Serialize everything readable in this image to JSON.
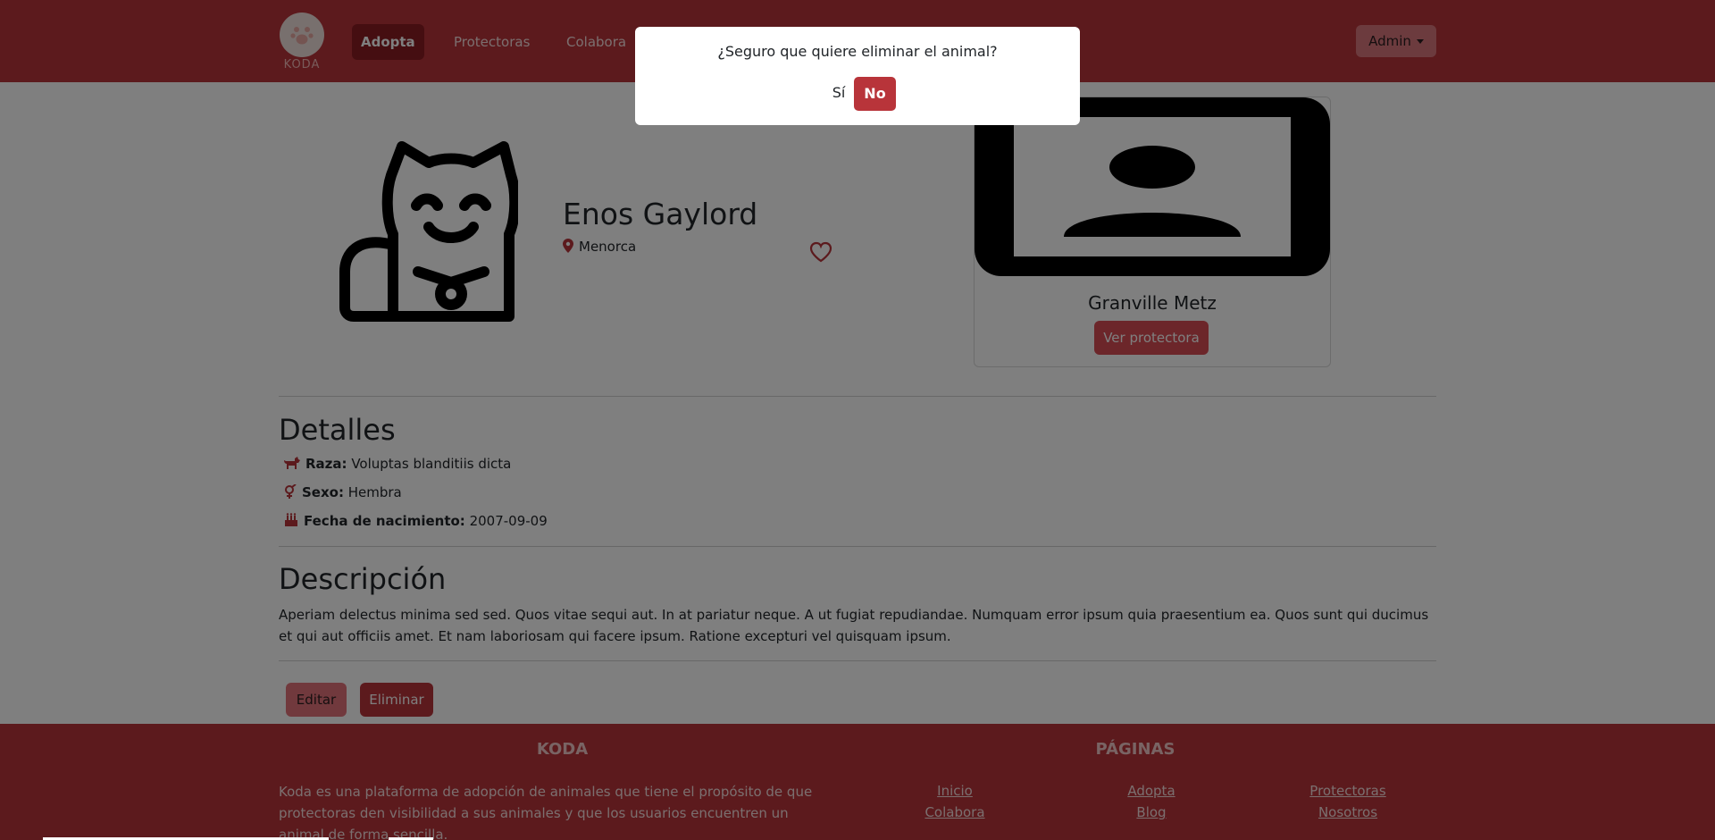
{
  "nav": {
    "logo_text": "KODA",
    "links": [
      "Adopta",
      "Protectoras",
      "Colabora"
    ],
    "active_link": "Adopta",
    "user_menu": "Admin"
  },
  "animal": {
    "name": "Enos Gaylord",
    "location": "Menorca"
  },
  "shelter": {
    "name": "Granville Metz",
    "button": "Ver protectora"
  },
  "details": {
    "title": "Detalles",
    "breed_label": "Raza:",
    "breed": "Voluptas blanditiis dicta",
    "sex_label": "Sexo:",
    "sex": "Hembra",
    "birth_label": "Fecha de nacimiento:",
    "birth": "2007-09-09"
  },
  "description": {
    "title": "Descripción",
    "text": "Aperiam delectus minima sed sed. Quos vitae sequi aut. In at pariatur neque. A ut fugiat repudiandae. Numquam error ipsum quia praesentium ea. Quos sunt qui ducimus et qui aut officiis amet. Et nam laboriosam qui facere ipsum. Ratione excepturi vel quisquam ipsum."
  },
  "actions": {
    "edit": "Editar",
    "delete": "Eliminar"
  },
  "footer": {
    "brand_title": "KODA",
    "brand_text": "Koda es una plataforma de adopción de animales que tiene el propósito de que protectoras den visibilidad a sus animales y que los usuarios encuentren un animal de forma sencilla.",
    "pages_title": "PÁGINAS",
    "links": [
      "Inicio",
      "Adopta",
      "Protectoras",
      "Colabora",
      "Blog",
      "Nosotros"
    ]
  },
  "modal": {
    "message": "¿Seguro que quiere eliminar el animal?",
    "yes": "Sí",
    "no": "No"
  },
  "colors": {
    "primary": "#b8343a",
    "primary_dark": "#8b1c23",
    "primary_light": "#d94c54"
  }
}
